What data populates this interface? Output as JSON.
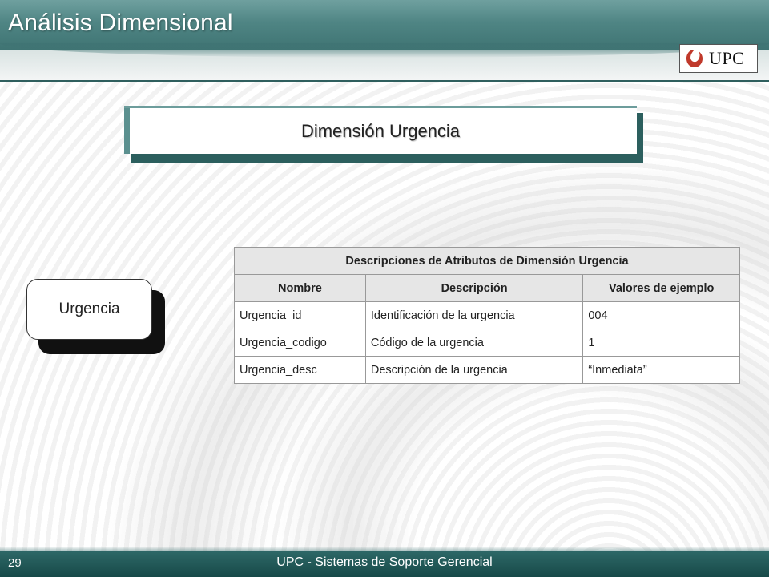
{
  "slide": {
    "title": "Análisis Dimensional",
    "section_title": "Dimensión Urgencia",
    "entity_label": "Urgencia",
    "logo_text": "UPC",
    "page_number": "29",
    "footer_text": "UPC - Sistemas de Soporte Gerencial"
  },
  "table": {
    "caption": "Descripciones de Atributos de Dimensión Urgencia",
    "headers": [
      "Nombre",
      "Descripción",
      "Valores de ejemplo"
    ],
    "rows": [
      [
        "Urgencia_id",
        "Identificación de la urgencia",
        "004"
      ],
      [
        "Urgencia_codigo",
        "Código de la urgencia",
        "1"
      ],
      [
        "Urgencia_desc",
        "Descripción de la urgencia",
        "“Inmediata”"
      ]
    ]
  },
  "colors": {
    "header_teal": "#4f8584",
    "footer_teal": "#174a49",
    "logo_red": "#c0392b"
  }
}
